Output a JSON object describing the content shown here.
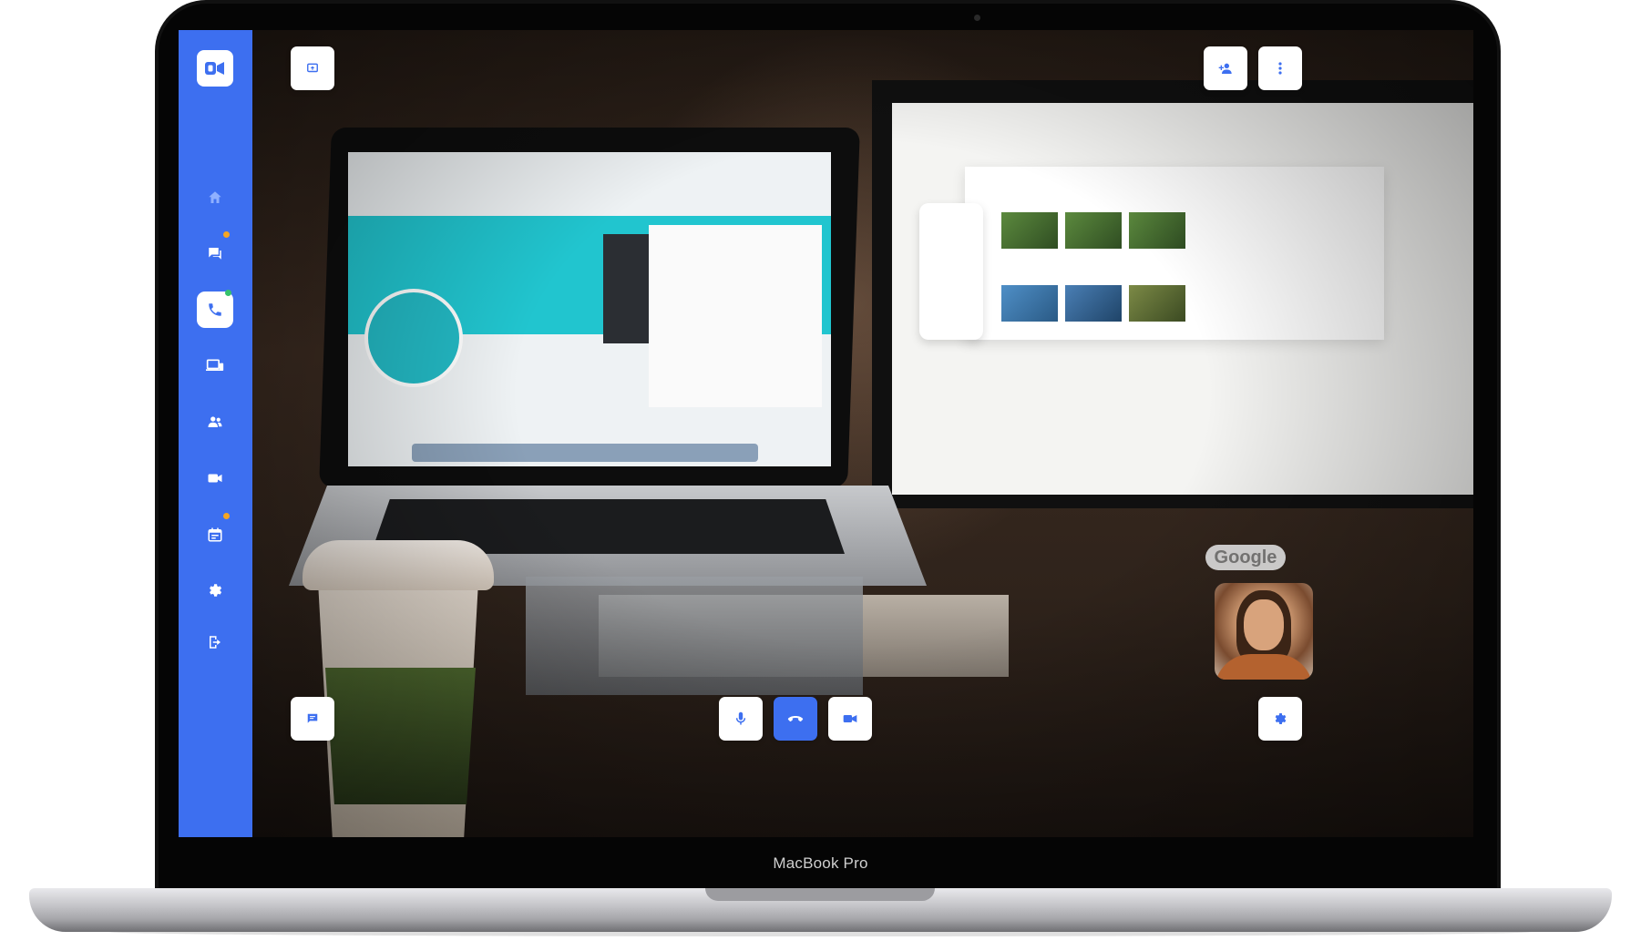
{
  "device": {
    "model_label": "MacBook Pro"
  },
  "colors": {
    "accent": "#3d6ff0",
    "sidebar_bg": "#3d6ff0",
    "badge_orange": "#f5a524",
    "badge_green": "#35c26b"
  },
  "app": {
    "logo_icon": "video-logo-icon",
    "sidebar": {
      "items": [
        {
          "icon": "home-icon",
          "active": false,
          "badge": null
        },
        {
          "icon": "chat-icon",
          "active": false,
          "badge": "orange"
        },
        {
          "icon": "phone-icon",
          "active": true,
          "badge": "green"
        },
        {
          "icon": "devices-icon",
          "active": false,
          "badge": null
        },
        {
          "icon": "contacts-icon",
          "active": false,
          "badge": null
        },
        {
          "icon": "video-camera-icon",
          "active": false,
          "badge": null
        },
        {
          "icon": "calendar-icon",
          "active": false,
          "badge": "orange"
        },
        {
          "icon": "settings-icon",
          "active": false,
          "badge": null
        },
        {
          "icon": "logout-icon",
          "active": false,
          "badge": null
        }
      ]
    },
    "call_controls": {
      "top_left": [
        "screen-share-icon"
      ],
      "top_right": [
        "add-person-icon",
        "more-options-icon"
      ],
      "bottom_left": [
        "chat-icon"
      ],
      "bottom_center": [
        "microphone-icon",
        "hang-up-icon",
        "video-camera-icon"
      ],
      "bottom_right": [
        "settings-icon"
      ]
    },
    "video_overlay": {
      "sticker_text": "Google"
    }
  }
}
